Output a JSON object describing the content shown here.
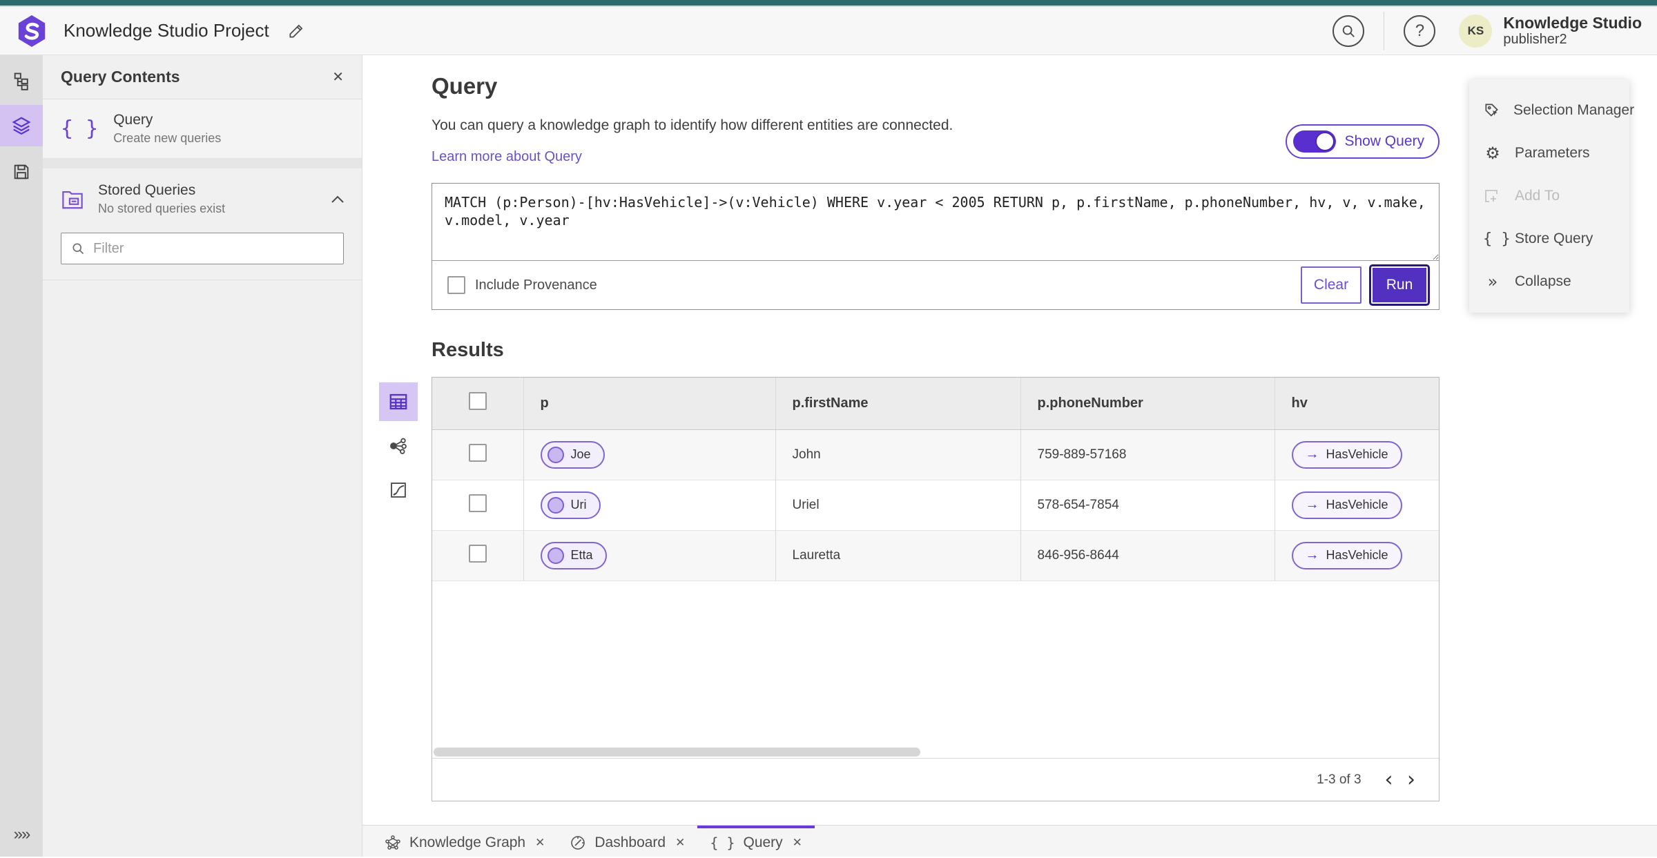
{
  "app": {
    "title": "Knowledge Studio Project",
    "product": "Knowledge Studio",
    "user": "publisher2",
    "avatar_initials": "KS"
  },
  "panel": {
    "title": "Query Contents",
    "query_item": {
      "title": "Query",
      "subtitle": "Create new queries"
    },
    "stored": {
      "title": "Stored Queries",
      "subtitle": "No stored queries exist"
    },
    "filter_placeholder": "Filter"
  },
  "query": {
    "title": "Query",
    "description": "You can query a knowledge graph to identify how different entities are connected.",
    "learn_more": "Learn more about Query",
    "show_query_label": "Show Query",
    "code": "MATCH (p:Person)-[hv:HasVehicle]->(v:Vehicle) WHERE v.year < 2005 RETURN p, p.firstName, p.phoneNumber, hv, v, v.make, v.model, v.year",
    "include_provenance_label": "Include Provenance",
    "clear_label": "Clear",
    "run_label": "Run"
  },
  "results": {
    "title": "Results",
    "columns": [
      "p",
      "p.firstName",
      "p.phoneNumber",
      "hv"
    ],
    "rows": [
      {
        "p": "Joe",
        "firstName": "John",
        "phoneNumber": "759-889-57168",
        "hv": "HasVehicle"
      },
      {
        "p": "Uri",
        "firstName": "Uriel",
        "phoneNumber": "578-654-7854",
        "hv": "HasVehicle"
      },
      {
        "p": "Etta",
        "firstName": "Lauretta",
        "phoneNumber": "846-956-8644",
        "hv": "HasVehicle"
      }
    ],
    "pagination": {
      "range": "1-3 of 3"
    }
  },
  "right_panel": {
    "items": [
      {
        "label": "Selection Manager"
      },
      {
        "label": "Parameters"
      },
      {
        "label": "Add To"
      },
      {
        "label": "Store Query"
      },
      {
        "label": "Collapse"
      }
    ]
  },
  "tabs": [
    {
      "label": "Knowledge Graph"
    },
    {
      "label": "Dashboard"
    },
    {
      "label": "Query"
    }
  ],
  "colors": {
    "primary_purple": "#5230c0",
    "selected_light_purple": "#d4c3f2",
    "teal_bar": "#2d696d",
    "link_purple": "#6a52c7",
    "avatar_bg": "#ececc6"
  }
}
